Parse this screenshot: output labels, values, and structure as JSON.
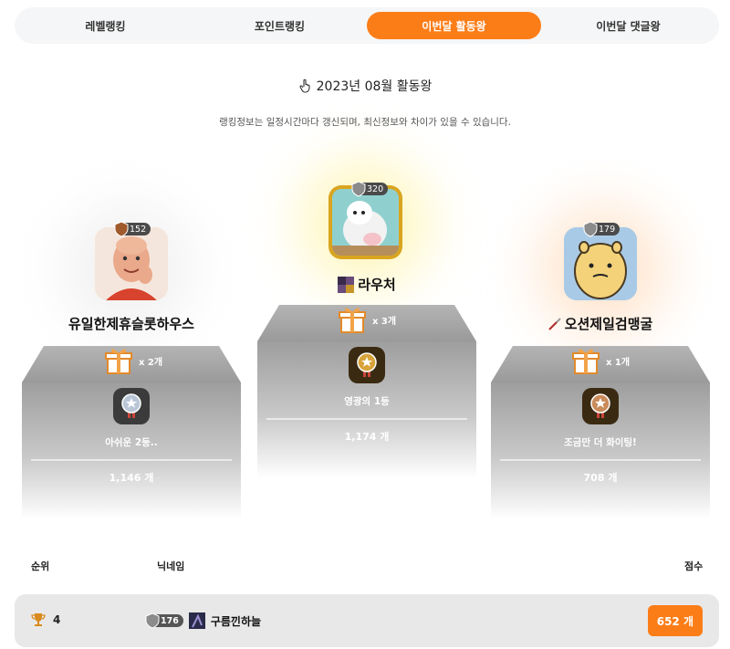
{
  "tabs": [
    {
      "label": "레벨랭킹"
    },
    {
      "label": "포인트랭킹"
    },
    {
      "label": "이번달 활동왕",
      "active": true
    },
    {
      "label": "이번달 댓글왕"
    }
  ],
  "header": {
    "title": "2023년 08월 활동왕",
    "subtitle": "랭킹정보는 일정시간마다 갱신되며, 최신정보와 차이가 있을 수 있습니다."
  },
  "podium": {
    "first": {
      "level": "320",
      "name": "라우처",
      "gift": "x 3개",
      "medal_label": "영광의 1등",
      "score": "1,174 개",
      "medal_color": "#c8902a",
      "glow": "#fff5b0"
    },
    "second": {
      "level": "152",
      "name": "유일한제휴슬롯하우스",
      "gift": "x 2개",
      "medal_label": "아쉬운 2등..",
      "score": "1,146 개",
      "medal_color": "#a7b6c8",
      "glow": "#e6e6e6"
    },
    "third": {
      "level": "179",
      "name": "오션제일검맹굴",
      "gift": "x 1개",
      "medal_label": "조금만 더 화이팅!",
      "score": "708 개",
      "medal_color": "#c98b5a",
      "glow": "#ffe2c7"
    }
  },
  "list": {
    "col_rank": "순위",
    "col_nick": "닉네임",
    "col_score": "점수",
    "rows": [
      {
        "rank": "4",
        "level": "176",
        "name": "구름낀하늘",
        "score": "652 개"
      }
    ]
  },
  "colors": {
    "accent": "#fb7d18"
  }
}
